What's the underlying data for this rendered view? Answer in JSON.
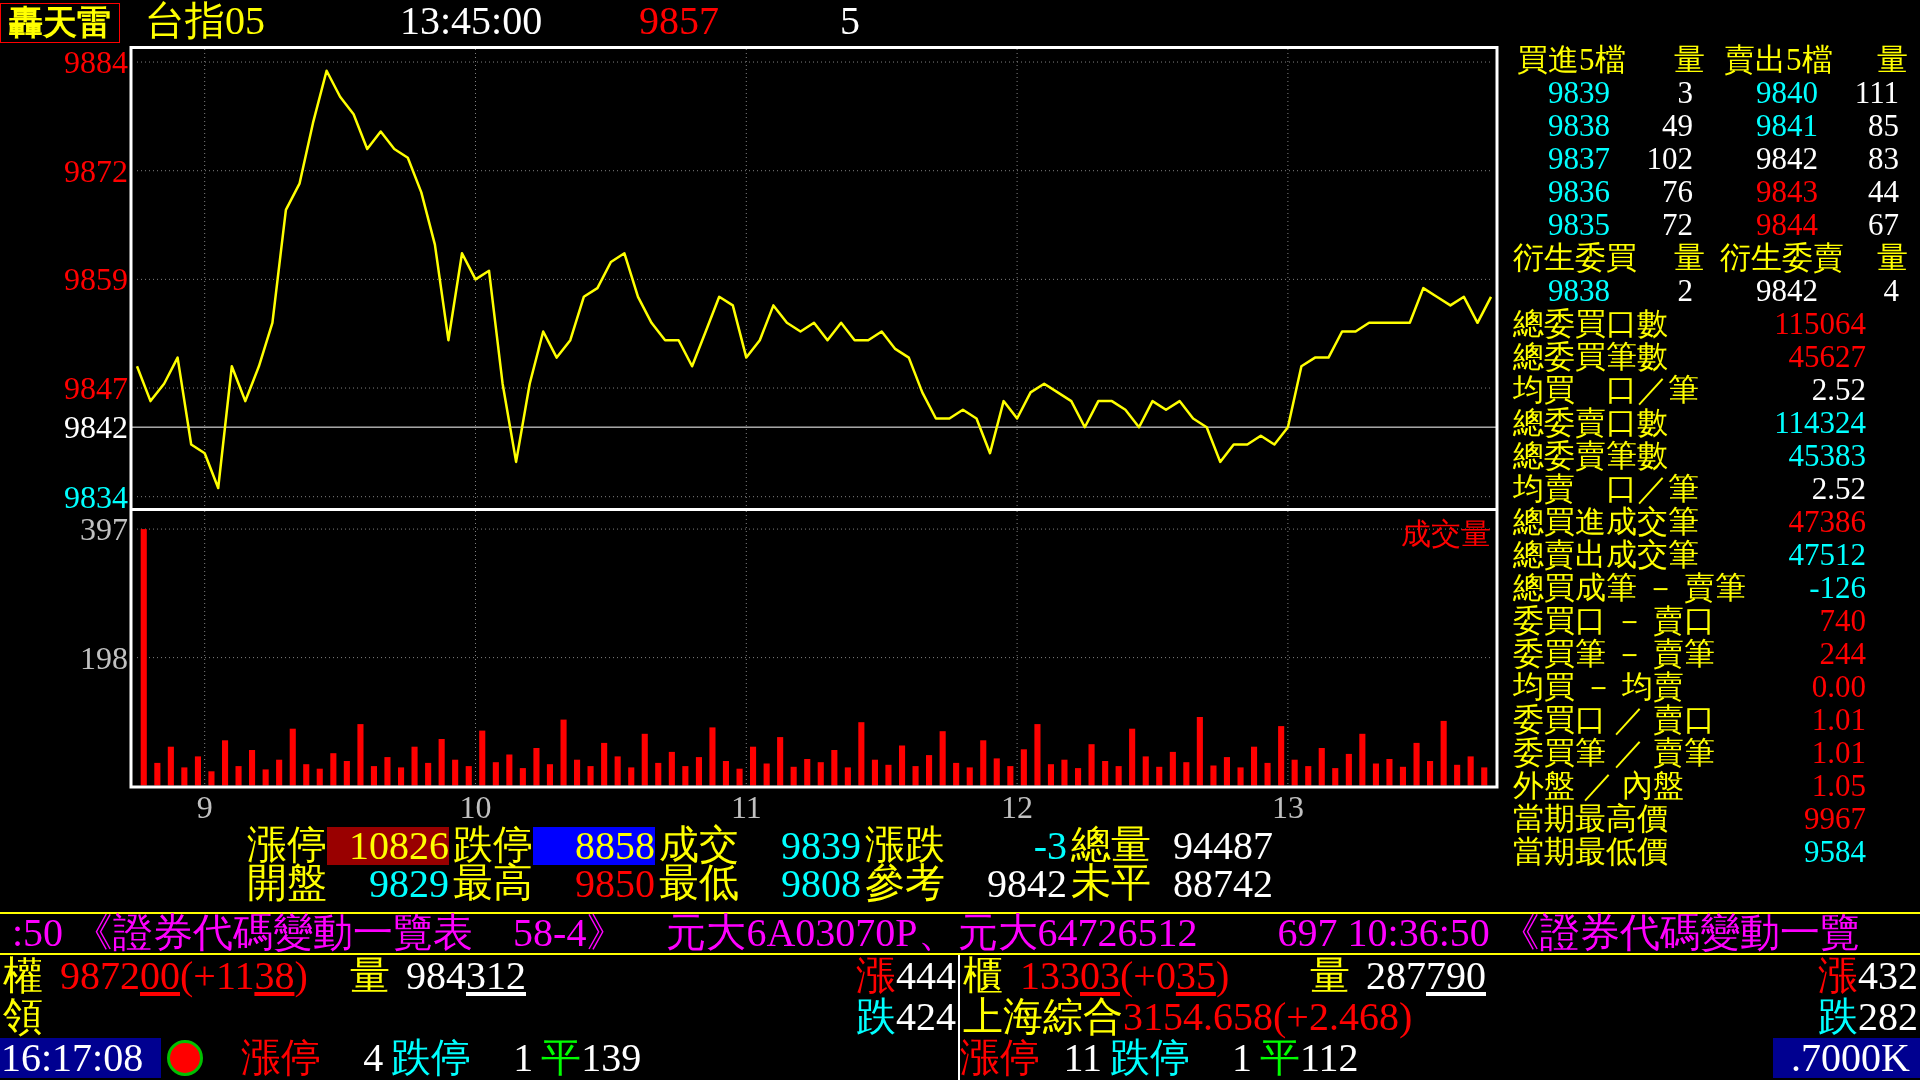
{
  "top_bar": {
    "logo": "轟天雷",
    "symbol": "台指05",
    "time": "13:45:00",
    "price": "9857",
    "change": "5"
  },
  "price_chart": {
    "chart_data": {
      "type": "line",
      "grid": true,
      "xlim": [
        8.75,
        13.75
      ],
      "ylim": [
        9832.7,
        9885.5
      ],
      "yticks": [
        9884,
        {
          "value": 9871.5,
          "label": "9872"
        },
        9859,
        {
          "value": 9846.5,
          "label": "9847"
        },
        9834
      ],
      "x": [
        8.75,
        8.8,
        8.85,
        8.9,
        8.95,
        9,
        9.05,
        9.1,
        9.15,
        9.2,
        9.25,
        9.3,
        9.35,
        9.4,
        9.45,
        9.5,
        9.55,
        9.6,
        9.65,
        9.7,
        9.75,
        9.8,
        9.85,
        9.9,
        9.95,
        10,
        10.05,
        10.1,
        10.15,
        10.2,
        10.25,
        10.3,
        10.35,
        10.4,
        10.45,
        10.5,
        10.55,
        10.6,
        10.65,
        10.7,
        10.75,
        10.8,
        10.85,
        10.9,
        10.95,
        11,
        11.05,
        11.1,
        11.15,
        11.2,
        11.25,
        11.3,
        11.35,
        11.4,
        11.45,
        11.5,
        11.55,
        11.6,
        11.65,
        11.7,
        11.75,
        11.8,
        11.85,
        11.9,
        11.95,
        12,
        12.05,
        12.1,
        12.15,
        12.2,
        12.25,
        12.3,
        12.35,
        12.4,
        12.45,
        12.5,
        12.55,
        12.6,
        12.65,
        12.7,
        12.75,
        12.8,
        12.85,
        12.9,
        12.95,
        13,
        13.05,
        13.1,
        13.15,
        13.2,
        13.25,
        13.3,
        13.35,
        13.4,
        13.45,
        13.5,
        13.55,
        13.6,
        13.65,
        13.7,
        13.75
      ],
      "series": [
        {
          "color": "#ffff00",
          "values": [
            9849,
            9845,
            9847,
            9850,
            9840,
            9839,
            9835,
            9849,
            9845,
            9849,
            9854,
            9867,
            9870,
            9877,
            9883,
            9880,
            9878,
            9874,
            9876,
            9874,
            9873,
            9869,
            9863,
            9852,
            9862,
            9859,
            9860,
            9847,
            9838,
            9847,
            9853,
            9850,
            9852,
            9857,
            9858,
            9861,
            9862,
            9857,
            9854,
            9852,
            9852,
            9849,
            9853,
            9857,
            9856,
            9850,
            9852,
            9856,
            9854,
            9853,
            9854,
            9852,
            9854,
            9852,
            9852,
            9853,
            9851,
            9850,
            9846,
            9843,
            9843,
            9844,
            9843,
            9839,
            9845,
            9843,
            9846,
            9847,
            9846,
            9845,
            9842,
            9845,
            9845,
            9844,
            9842,
            9845,
            9844,
            9845,
            9843,
            9842,
            9838,
            9840,
            9840,
            9841,
            9840,
            9842,
            9849,
            9850,
            9850,
            9853,
            9853,
            9854,
            9854,
            9854,
            9854,
            9858,
            9857,
            9856,
            9857,
            9854,
            9857
          ]
        }
      ],
      "ref_lines": [
        {
          "axis": "y",
          "value": 9842,
          "label": "9842"
        }
      ]
    }
  },
  "volume_chart": {
    "chart_data": {
      "type": "bar",
      "grid": true,
      "title": "成交量",
      "xlim": [
        8.75,
        13.75
      ],
      "ylim": [
        0,
        425
      ],
      "xticks": [
        9,
        10,
        11,
        12,
        13
      ],
      "yticks": [
        397,
        198
      ],
      "x": [
        8.775,
        8.825,
        8.875,
        8.925,
        8.975,
        9.025,
        9.075,
        9.125,
        9.175,
        9.225,
        9.275,
        9.325,
        9.375,
        9.425,
        9.475,
        9.525,
        9.575,
        9.625,
        9.675,
        9.725,
        9.775,
        9.825,
        9.875,
        9.925,
        9.975,
        10.025,
        10.075,
        10.125,
        10.175,
        10.225,
        10.275,
        10.325,
        10.375,
        10.425,
        10.475,
        10.525,
        10.575,
        10.625,
        10.675,
        10.725,
        10.775,
        10.825,
        10.875,
        10.925,
        10.975,
        11.025,
        11.075,
        11.125,
        11.175,
        11.225,
        11.275,
        11.325,
        11.375,
        11.425,
        11.475,
        11.525,
        11.575,
        11.625,
        11.675,
        11.725,
        11.775,
        11.825,
        11.875,
        11.925,
        11.975,
        12.025,
        12.075,
        12.125,
        12.175,
        12.225,
        12.275,
        12.325,
        12.375,
        12.425,
        12.475,
        12.525,
        12.575,
        12.625,
        12.675,
        12.725,
        12.775,
        12.825,
        12.875,
        12.925,
        12.975,
        13.025,
        13.075,
        13.125,
        13.175,
        13.225,
        13.275,
        13.325,
        13.375,
        13.425,
        13.475,
        13.525,
        13.575,
        13.625,
        13.675,
        13.725
      ],
      "series": [
        {
          "color": "#ff0000",
          "values": [
            397,
            35,
            60,
            28,
            45,
            22,
            70,
            30,
            55,
            25,
            40,
            88,
            33,
            26,
            50,
            38,
            95,
            30,
            44,
            28,
            60,
            35,
            72,
            40,
            30,
            85,
            36,
            48,
            27,
            58,
            33,
            102,
            40,
            30,
            66,
            45,
            28,
            80,
            35,
            52,
            30,
            44,
            90,
            38,
            26,
            60,
            34,
            75,
            29,
            41,
            36,
            55,
            28,
            98,
            40,
            32,
            62,
            30,
            47,
            84,
            35,
            28,
            70,
            42,
            30,
            56,
            95,
            33,
            40,
            27,
            64,
            38,
            30,
            88,
            45,
            29,
            52,
            36,
            106,
            31,
            44,
            28,
            60,
            35,
            92,
            40,
            30,
            58,
            27,
            49,
            80,
            34,
            41,
            29,
            66,
            38,
            100,
            32,
            45,
            28
          ]
        }
      ]
    }
  },
  "quote": {
    "rows": [
      [
        {
          "kind": "boxed",
          "label": "漲停",
          "value": "10826",
          "color": "#990000"
        },
        {
          "kind": "boxed",
          "label": "跌停",
          "value": "8858",
          "color": "#0000ff"
        },
        {
          "kind": "plain",
          "label": "成交",
          "value": "9839",
          "color": "#00ffff"
        },
        {
          "kind": "plain",
          "label": "漲跌",
          "value": "-3",
          "color": "#00ffff"
        },
        {
          "kind": "plain",
          "label": "總量",
          "value": "94487",
          "color": "#ffffff"
        }
      ],
      [
        {
          "kind": "plain",
          "label": "開盤",
          "value": "9829",
          "color": "#00ffff"
        },
        {
          "kind": "plain",
          "label": "最高",
          "value": "9850",
          "color": "#ff0000"
        },
        {
          "kind": "plain",
          "label": "最低",
          "value": "9808",
          "color": "#00ffff"
        },
        {
          "kind": "plain",
          "label": "參考",
          "value": "9842",
          "color": "#ffffff"
        },
        {
          "kind": "plain",
          "label": "未平",
          "value": "88742",
          "color": "#ffffff"
        }
      ]
    ]
  },
  "order_book": {
    "headers": [
      "買進5檔",
      "量",
      "賣出5檔",
      "量"
    ],
    "bids": [
      {
        "price": "9839",
        "quantity": "3",
        "color": "#00ffff"
      },
      {
        "price": "9838",
        "quantity": "49",
        "color": "#00ffff"
      },
      {
        "price": "9837",
        "quantity": "102",
        "color": "#00ffff"
      },
      {
        "price": "9836",
        "quantity": "76",
        "color": "#00ffff"
      },
      {
        "price": "9835",
        "quantity": "72",
        "color": "#00ffff"
      }
    ],
    "asks": [
      {
        "price": "9840",
        "quantity": "111",
        "color": "#00ffff"
      },
      {
        "price": "9841",
        "quantity": "85",
        "color": "#00ffff"
      },
      {
        "price": "9842",
        "quantity": "83",
        "color": "#ffffff"
      },
      {
        "price": "9843",
        "quantity": "44",
        "color": "#ff0000"
      },
      {
        "price": "9844",
        "quantity": "67",
        "color": "#ff0000"
      }
    ]
  },
  "derivative_orders": {
    "headers": [
      "衍生委買",
      "量",
      "衍生委賣",
      "量"
    ],
    "bid": {
      "price": "9838",
      "quantity": "2",
      "color": "#00ffff"
    },
    "ask": {
      "price": "9842",
      "quantity": "4",
      "color": "#ffffff"
    }
  },
  "stats": [
    {
      "label": "總委買口數",
      "value": "115064",
      "color": "#ff0000"
    },
    {
      "label": "總委買筆數",
      "value": "45627",
      "color": "#ff0000"
    },
    {
      "label": "均買　口／筆",
      "value": "2.52",
      "color": "#ffffff"
    },
    {
      "label": "總委賣口數",
      "value": "114324",
      "color": "#00ffff"
    },
    {
      "label": "總委賣筆數",
      "value": "45383",
      "color": "#00ffff"
    },
    {
      "label": "均賣　口／筆",
      "value": "2.52",
      "color": "#ffffff"
    },
    {
      "label": "總買進成交筆",
      "value": "47386",
      "color": "#ff0000"
    },
    {
      "label": "總賣出成交筆",
      "value": "47512",
      "color": "#00ffff"
    },
    {
      "label": "總買成筆 － 賣筆",
      "value": "-126",
      "color": "#00ffff"
    },
    {
      "label": "委買口 － 賣口",
      "value": "740",
      "color": "#ff0000"
    },
    {
      "label": "委買筆 － 賣筆",
      "value": "244",
      "color": "#ff0000"
    },
    {
      "label": "均買 － 均賣",
      "value": "0.00",
      "color": "#ff0000"
    },
    {
      "label": "委買口 ／ 賣口",
      "value": "1.01",
      "color": "#ff0000"
    },
    {
      "label": "委買筆 ／ 賣筆",
      "value": "1.01",
      "color": "#ff0000"
    },
    {
      "label": "外盤 ／ 內盤",
      "value": "1.05",
      "color": "#ff0000"
    },
    {
      "label": "當期最高價",
      "value": "9967",
      "color": "#ff0000"
    },
    {
      "label": "當期最低價",
      "value": "9584",
      "color": "#00ffff"
    }
  ],
  "ticker": {
    "text": ":50 《證券代碼變動一覽表　58-4》　元大6A03070P、元大64726512　　697 10:36:50 《證券代碼變動一覽"
  },
  "markets": [
    {
      "index": {
        "label": "權",
        "value_parts": [
          {
            "text": "9872",
            "underlined": false
          },
          {
            "text": "00",
            "underlined": true
          },
          {
            "text": "(+11",
            "underlined": false
          },
          {
            "text": "38",
            "underlined": true
          },
          {
            "text": ")",
            "underlined": false
          }
        ],
        "volume_label": "量",
        "volume_parts": [
          {
            "text": "984",
            "underlined": false
          },
          {
            "text": "312",
            "underlined": true
          }
        ]
      },
      "second": {
        "label": "領"
      },
      "advances": {
        "label": "漲",
        "value": "444"
      },
      "declines": {
        "label": "跌",
        "value": "424"
      },
      "clock": "16:17:08",
      "limit_up": {
        "label": "漲停",
        "value": "4"
      },
      "limit_down": {
        "label": "跌停",
        "value": "1"
      },
      "unchanged": {
        "label": "平",
        "value": "139"
      }
    },
    {
      "index": {
        "label": "櫃",
        "value_parts": [
          {
            "text": "133",
            "underlined": false
          },
          {
            "text": "03",
            "underlined": true
          },
          {
            "text": "(+0",
            "underlined": false
          },
          {
            "text": "35",
            "underlined": true
          },
          {
            "text": ")",
            "underlined": false
          }
        ],
        "volume_label": "量",
        "volume_parts": [
          {
            "text": "287",
            "underlined": false
          },
          {
            "text": "790",
            "underlined": true
          }
        ]
      },
      "second": {
        "label": "上海綜合",
        "value": "3154.658(+2.468)"
      },
      "advances": {
        "label": "漲",
        "value": "432"
      },
      "declines": {
        "label": "跌",
        "value": "282"
      },
      "limit_up": {
        "label": "漲停",
        "value": "11"
      },
      "limit_down": {
        "label": "跌停",
        "value": "1"
      },
      "unchanged": {
        "label": "平",
        "value": "112"
      },
      "badge": ".7000K"
    }
  ]
}
